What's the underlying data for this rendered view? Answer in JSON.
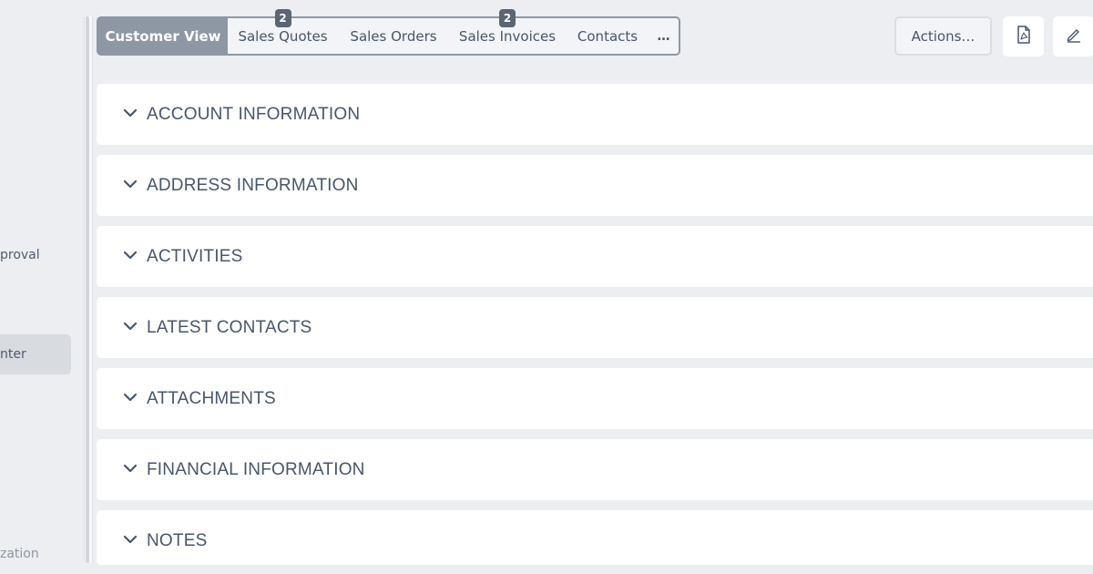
{
  "sidebar": {
    "items": [
      {
        "label": "proval"
      },
      {
        "label": "nter"
      },
      {
        "label": "zation"
      }
    ]
  },
  "tabs": [
    {
      "label": "Customer View",
      "badge": ""
    },
    {
      "label": "Sales Quotes",
      "badge": "2"
    },
    {
      "label": "Sales Orders",
      "badge": ""
    },
    {
      "label": "Sales Invoices",
      "badge": "2"
    },
    {
      "label": "Contacts",
      "badge": ""
    },
    {
      "label": "…",
      "badge": ""
    }
  ],
  "toolbar": {
    "actions_label": "Actions…"
  },
  "icons": {
    "pdf": "pdf-file-icon",
    "edit": "pencil-icon",
    "chevron": "chevron-down-icon"
  },
  "sections": [
    {
      "title": "ACCOUNT INFORMATION"
    },
    {
      "title": "ADDRESS INFORMATION"
    },
    {
      "title": "ACTIVITIES"
    },
    {
      "title": "LATEST CONTACTS"
    },
    {
      "title": "ATTACHMENTS"
    },
    {
      "title": "FINANCIAL INFORMATION"
    },
    {
      "title": "NOTES"
    }
  ],
  "colors": {
    "background": "#eceef2",
    "tab_active": "#8e98a5",
    "badge": "#5b6574",
    "text": "#47566a"
  }
}
